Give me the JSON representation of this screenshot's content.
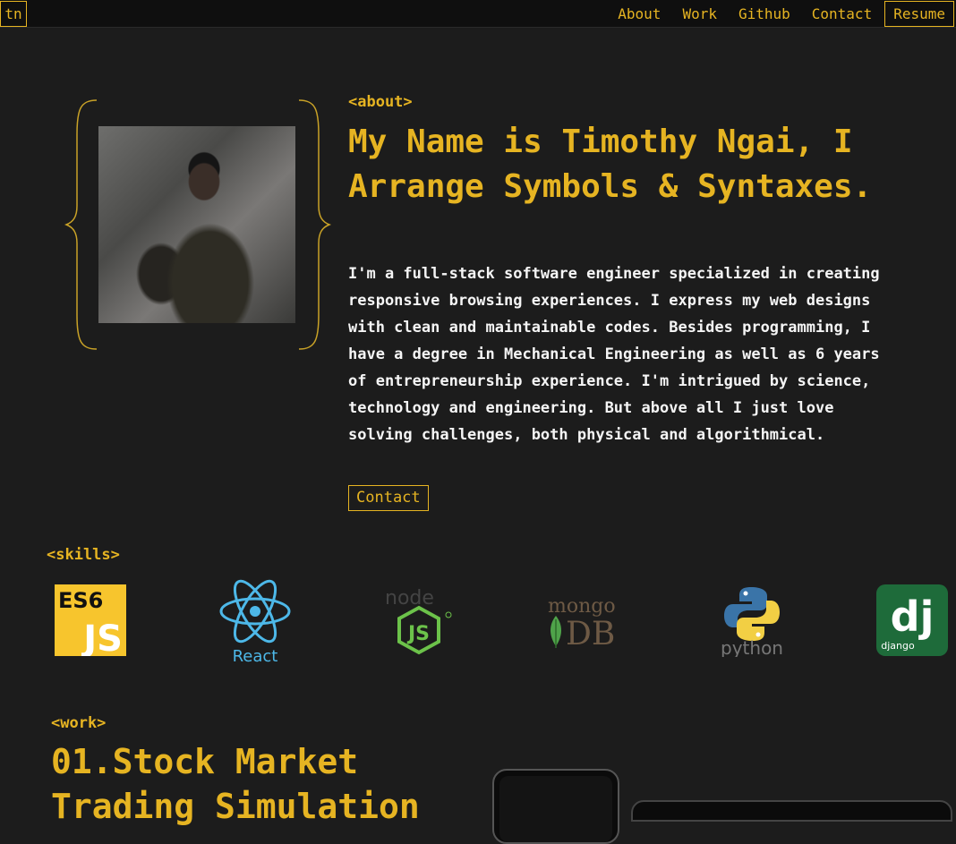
{
  "nav": {
    "logo": "tn",
    "links": [
      "About",
      "Work",
      "Github",
      "Contact"
    ],
    "resume": "Resume"
  },
  "about": {
    "tag": "<about>",
    "headline": "My Name is Timothy Ngai, I Arrange Symbols & Syntaxes.",
    "bio": "I'm a full-stack software engineer specialized in creating responsive browsing experiences. I express my web designs with clean and maintainable codes. Besides programming, I have a degree in Mechanical Engineering as well as 6 years of entrepreneurship experience. I'm intrigued by science, technology and engineering. But above all I just love solving challenges, both physical and algorithmical.",
    "contact_button": "Contact"
  },
  "skills": {
    "tag": "<skills>",
    "items": [
      {
        "name": "es6-js-logo",
        "text1": "ES6",
        "text2": "JS",
        "color": "#f7c52d"
      },
      {
        "name": "react-logo",
        "text": "React",
        "color": "#4db8e8"
      },
      {
        "name": "nodejs-logo",
        "text": "node",
        "color": "#6cc24a"
      },
      {
        "name": "mongodb-logo",
        "text1": "mongo",
        "text2": "DB",
        "color": "#4fa34a"
      },
      {
        "name": "python-logo",
        "text": "python",
        "color": "#3a74a8"
      },
      {
        "name": "django-logo",
        "text1": "dj",
        "text2": "django",
        "color": "#1e6b3a"
      }
    ]
  },
  "work": {
    "tag": "<work>",
    "title": "01.Stock Market Trading Simulation"
  }
}
